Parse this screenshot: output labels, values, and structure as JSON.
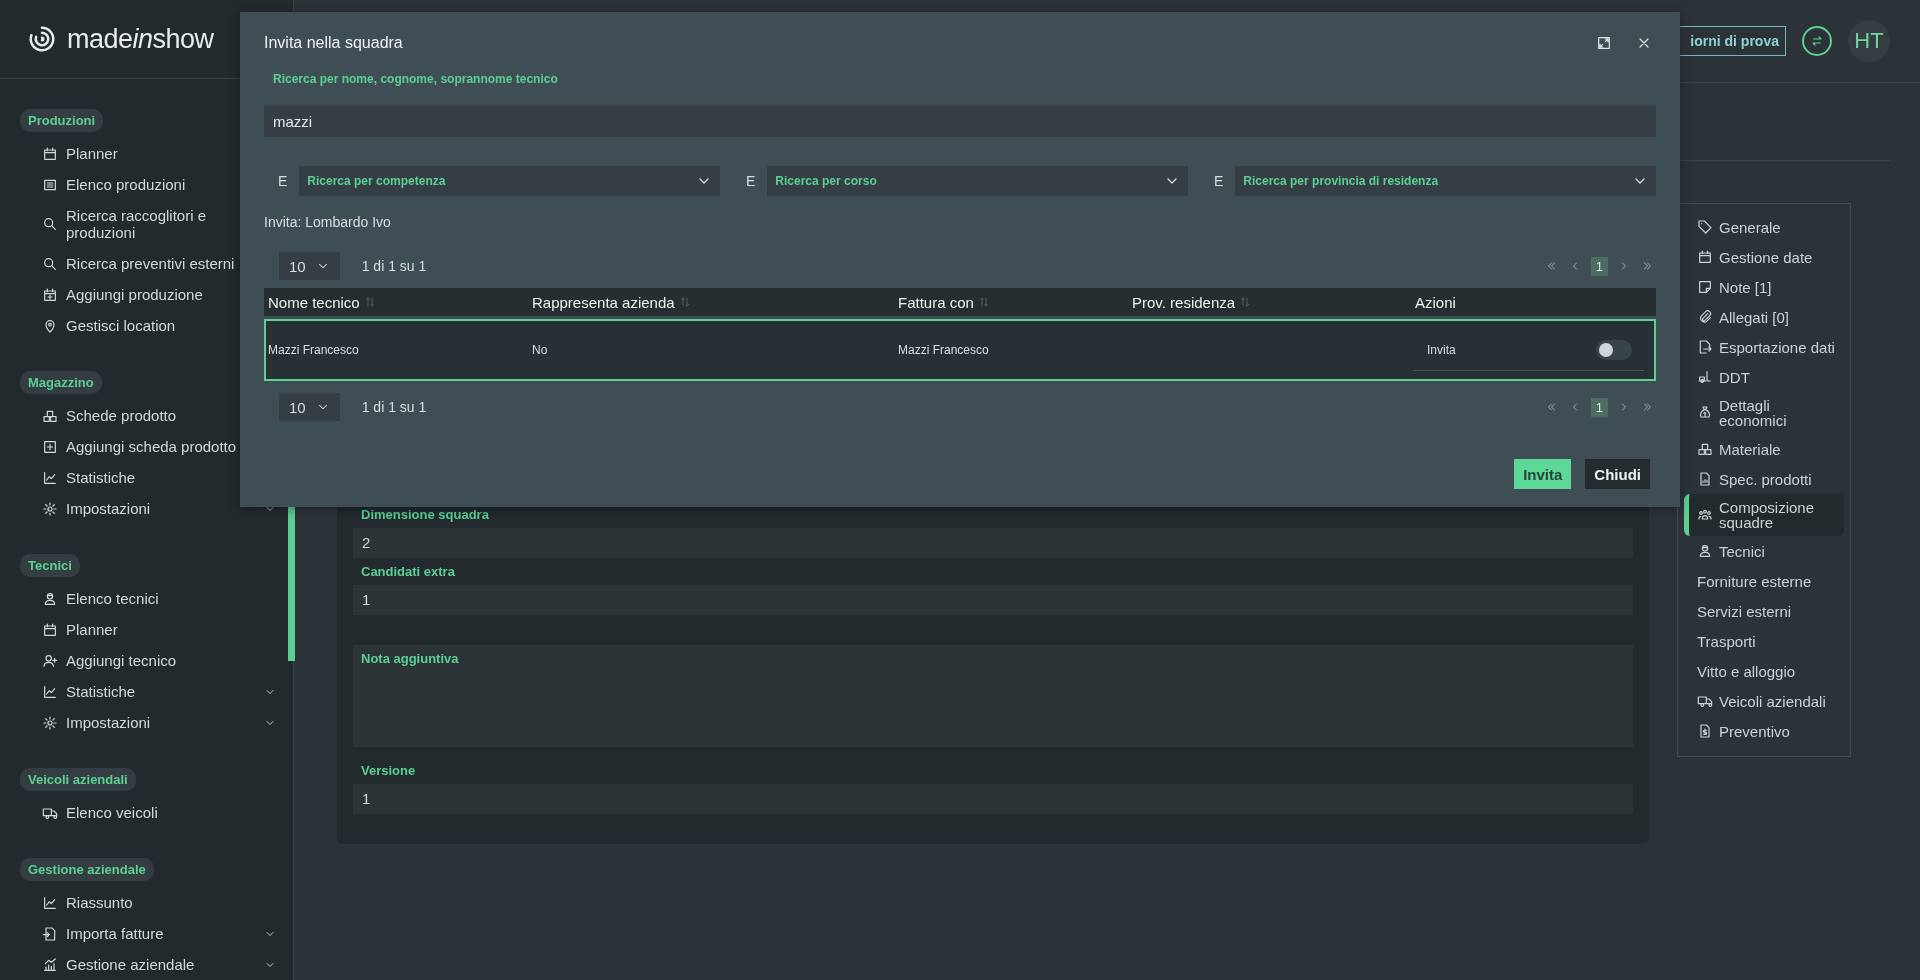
{
  "brand": {
    "logo_parts": [
      {
        "text": "made",
        "italic": false
      },
      {
        "text": "in",
        "italic": true
      },
      {
        "text": "show",
        "italic": false
      }
    ]
  },
  "sidebar": {
    "sections": [
      {
        "title": "Produzioni",
        "items": [
          {
            "label": "Planner"
          },
          {
            "label": "Elenco produzioni"
          },
          {
            "label": "Ricerca raccoglitori e produzioni"
          },
          {
            "label": "Ricerca preventivi esterni"
          },
          {
            "label": "Aggiungi produzione"
          },
          {
            "label": "Gestisci location"
          }
        ]
      },
      {
        "title": "Magazzino",
        "items": [
          {
            "label": "Schede prodotto"
          },
          {
            "label": "Aggiungi scheda prodotto"
          },
          {
            "label": "Statistiche"
          },
          {
            "label": "Impostazioni",
            "has_submenu": true
          }
        ]
      },
      {
        "title": "Tecnici",
        "items": [
          {
            "label": "Elenco tecnici",
            "has_submenu": false
          },
          {
            "label": "Planner",
            "has_submenu": false
          },
          {
            "label": "Aggiungi tecnico",
            "has_submenu": false
          },
          {
            "label": "Statistiche",
            "has_submenu": true
          },
          {
            "label": "Impostazioni",
            "has_submenu": true
          }
        ]
      },
      {
        "title": "Veicoli aziendali",
        "items": [
          {
            "label": "Elenco veicoli",
            "has_submenu": false
          }
        ]
      },
      {
        "title": "Gestione aziendale",
        "items": [
          {
            "label": "Riassunto",
            "has_submenu": false
          },
          {
            "label": "Importa fatture",
            "has_submenu": true
          },
          {
            "label": "Gestione aziendale",
            "has_submenu": true
          }
        ]
      }
    ]
  },
  "topbar": {
    "trial_button": "iorni di prova",
    "avatar": "HT"
  },
  "form": {
    "fields": [
      {
        "kind": "input",
        "label": "Dimensione squadra",
        "value": "2"
      },
      {
        "kind": "input",
        "label": "Candidati extra",
        "value": "1"
      },
      {
        "kind": "textarea",
        "label": "Nota aggiuntiva"
      },
      {
        "kind": "input",
        "label": "Versione",
        "value": "1"
      }
    ]
  },
  "section_nav": {
    "items": [
      {
        "label": "Generale",
        "selected": false
      },
      {
        "label": "Gestione date",
        "selected": false
      },
      {
        "label": "Note [1]",
        "selected": false
      },
      {
        "label": "Allegati [0]",
        "selected": false
      },
      {
        "label": "Esportazione dati",
        "selected": false
      },
      {
        "label": "DDT",
        "selected": false
      },
      {
        "label": "Dettagli economici",
        "selected": false
      },
      {
        "label": "Materiale",
        "selected": false
      },
      {
        "label": "Spec. prodotti",
        "selected": false
      },
      {
        "label": "Composizione squadre",
        "selected": true
      },
      {
        "label": "Tecnici",
        "selected": false
      },
      {
        "label": "Forniture esterne",
        "selected": false
      },
      {
        "label": "Servizi esterni",
        "selected": false
      },
      {
        "label": "Trasporti",
        "selected": false
      },
      {
        "label": "Vitto e alloggio",
        "selected": false
      },
      {
        "label": "Veicoli aziendali",
        "selected": false
      },
      {
        "label": "Preventivo",
        "selected": false
      }
    ]
  },
  "modal": {
    "title": "Invita nella squadra",
    "search": {
      "label": "Ricerca per nome, cognome, soprannome tecnico",
      "value": "mazzi"
    },
    "filters": [
      {
        "prefix": "E",
        "placeholder": "Ricerca per competenza"
      },
      {
        "prefix": "E",
        "placeholder": "Ricerca per corso"
      },
      {
        "prefix": "E",
        "placeholder": "Ricerca per provincia di residenza"
      }
    ],
    "invite_summary": "Invita: Lombardo Ivo",
    "pagination_top": {
      "page_size": "10",
      "range": "1 di 1 su 1",
      "pages": [
        {
          "label": "1",
          "selected": true
        }
      ]
    },
    "table": {
      "columns": [
        {
          "label": "Nome tecnico",
          "sortable": true
        },
        {
          "label": "Rappresenta azienda",
          "sortable": true
        },
        {
          "label": "Fattura con",
          "sortable": true
        },
        {
          "label": "Prov. residenza",
          "sortable": true
        },
        {
          "label": "Azioni",
          "sortable": false
        }
      ],
      "rows": [
        {
          "selected": true,
          "cells": [
            "Mazzi Francesco",
            "No",
            "Mazzi Francesco"
          ],
          "action_label": "Invita",
          "on": false
        }
      ]
    },
    "pagination_bottom": {
      "page_size": "10",
      "range": "1 di 1 su 1",
      "pages": [
        {
          "label": "1",
          "selected": true
        }
      ]
    },
    "buttons": [
      {
        "label": "Invita",
        "kind": "primary"
      },
      {
        "label": "Chiudi",
        "kind": "secondary"
      }
    ]
  }
}
